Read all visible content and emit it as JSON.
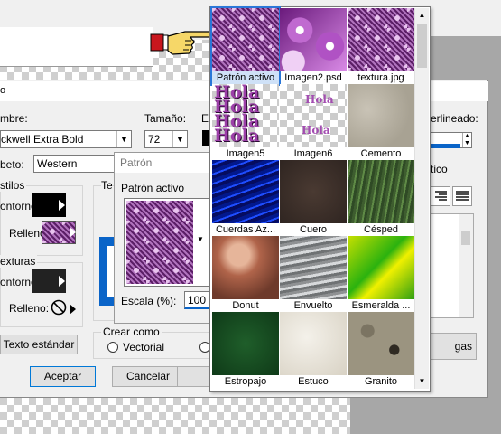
{
  "dialog": {
    "name_label": "mbre:",
    "font_value": "ckwell Extra Bold",
    "size_label": "Tamaño:",
    "size_value": "72",
    "script_label": "beto:",
    "script_value": "Western",
    "leading_label": "erlineado:",
    "italic_label": "tico",
    "styles_section": "stilos",
    "outline_label": "ontorno:",
    "fill_label": "Relleno:",
    "textures_section": "exturas",
    "outline2_label": "ontorno:",
    "fill2_label": "Relleno:",
    "te_label": "Te",
    "standard_text_button": "Texto estándar",
    "create_as_label": "Crear como",
    "vector_option": "Vectorial",
    "ok_button": "Aceptar",
    "cancel_button": "Cancelar",
    "gas_button": "gas",
    "ep_label": "E",
    "p_label": "o"
  },
  "pattern_dialog": {
    "title": "Patrón",
    "active_label": "Patrón activo",
    "scale_label": "Escala (%):",
    "scale_value": "100"
  },
  "popup": {
    "tiles": [
      {
        "label": "Patrón activo",
        "kind": "pattern"
      },
      {
        "label": "Imagen2.psd",
        "kind": "flowers"
      },
      {
        "label": "textura.jpg",
        "kind": "pattern"
      },
      {
        "label": "Imagen5",
        "kind": "hola",
        "text": "Hola"
      },
      {
        "label": "Imagen6",
        "kind": "hola2",
        "text": "Hola"
      },
      {
        "label": "Cemento",
        "kind": "cement"
      },
      {
        "label": "Cuerdas Az...",
        "kind": "blue"
      },
      {
        "label": "Cuero",
        "kind": "leather"
      },
      {
        "label": "Césped",
        "kind": "grass"
      },
      {
        "label": "Donut",
        "kind": "donut"
      },
      {
        "label": "Envuelto",
        "kind": "wrap"
      },
      {
        "label": "Esmeralda ...",
        "kind": "emerald"
      },
      {
        "label": "Estropajo",
        "kind": "scrub"
      },
      {
        "label": "Estuco",
        "kind": "stucco"
      },
      {
        "label": "Granito",
        "kind": "granite"
      }
    ]
  },
  "colors": {
    "selection": "#2a77d8",
    "pattern_purple": "#7a2f87"
  },
  "icons": {
    "pointer": "pointing-hand-icon",
    "no_texture": "no-symbol-icon"
  }
}
